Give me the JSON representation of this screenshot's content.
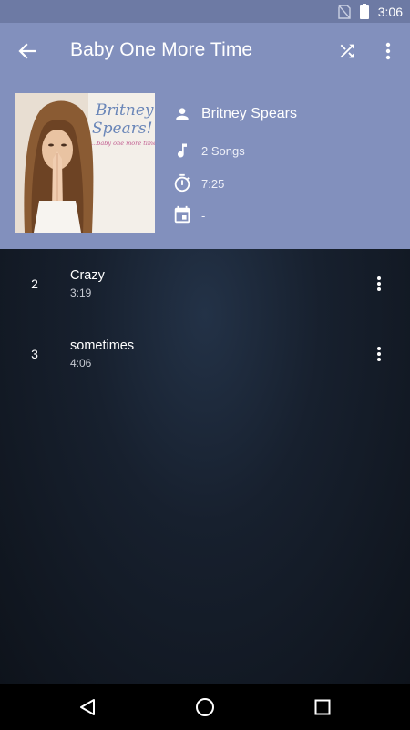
{
  "status_bar": {
    "time": "3:06",
    "icons": [
      "no-sim-icon",
      "battery-icon"
    ]
  },
  "app_bar": {
    "title": "Baby One More Time",
    "icons": [
      "arrow-back-icon",
      "shuffle-icon",
      "more-vert-icon"
    ]
  },
  "album": {
    "cover_icon": "album-cover-image",
    "artist": "Britney Spears",
    "song_count": "2 Songs",
    "duration": "7:25",
    "year": "-",
    "info_icons": [
      "person-icon",
      "music-note-icon",
      "timer-icon",
      "calendar-icon"
    ]
  },
  "tracks": [
    {
      "number": "2",
      "title": "Crazy",
      "duration": "3:19"
    },
    {
      "number": "3",
      "title": "sometimes",
      "duration": "4:06"
    }
  ],
  "nav_bar": {
    "icons": [
      "back-triangle-icon",
      "home-circle-icon",
      "recents-square-icon"
    ]
  },
  "colors": {
    "status_bar": "#6d7aa4",
    "header": "#8290bd",
    "list_background": "#17202e",
    "nav_bar": "#000000"
  }
}
